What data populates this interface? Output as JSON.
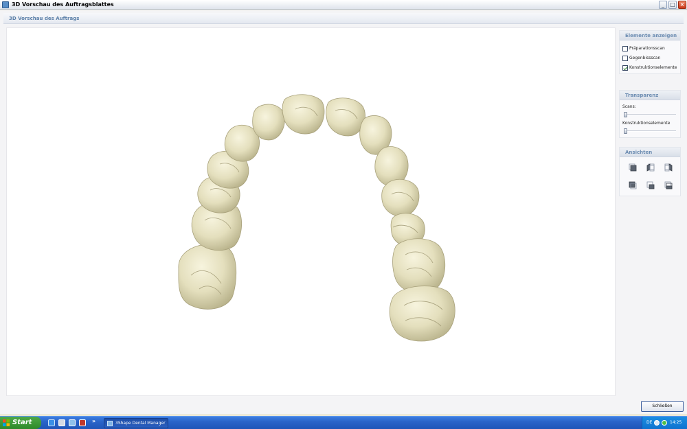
{
  "window": {
    "title": "3D Vorschau des Auftragsblattes"
  },
  "header": {
    "title": "3D Vorschau des Auftrags"
  },
  "panel": {
    "show_elements": {
      "title": "Elemente anzeigen",
      "items": [
        {
          "label": "Präparationsscan",
          "checked": false
        },
        {
          "label": "Gegenbissscan",
          "checked": false
        },
        {
          "label": "Konstruktionselemente",
          "checked": true
        }
      ]
    },
    "transparency": {
      "title": "Transparenz",
      "scans_label": "Scans:",
      "scans_value": 0,
      "elements_label": "Konstruktionselemente",
      "elements_value": 0
    },
    "views": {
      "title": "Ansichten",
      "buttons": [
        "view-front-icon",
        "view-left-icon",
        "view-right-icon",
        "view-top-icon",
        "view-bottom-icon",
        "view-back-icon"
      ]
    }
  },
  "footer": {
    "close_label": "Schließen"
  },
  "taskbar": {
    "start_label": "Start",
    "task_label": "3Shape Dental Manager",
    "language": "DE",
    "clock": "14:25"
  },
  "colors": {
    "tooth": "#e7e3c3",
    "tooth_shadow": "#b9b38c",
    "accent": "#6d8db2"
  }
}
